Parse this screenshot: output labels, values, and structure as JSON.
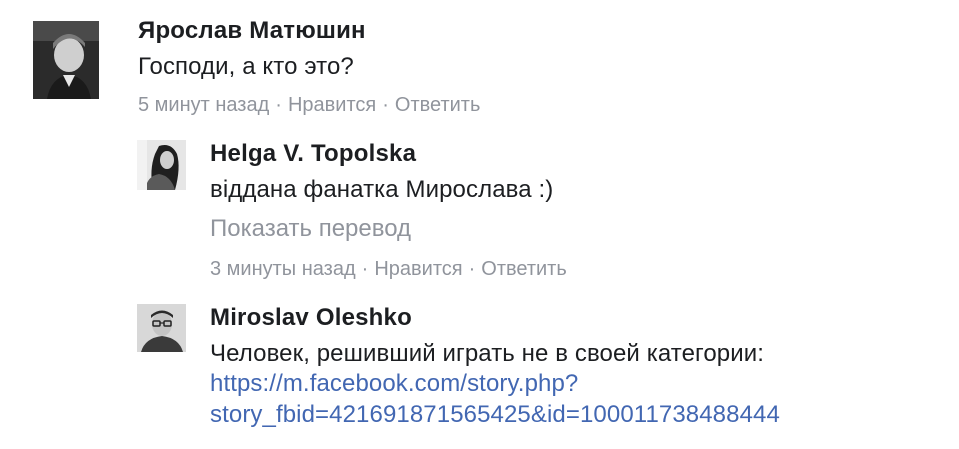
{
  "comments": [
    {
      "author": "Ярослав Матюшин",
      "text": "Господи, а кто это?",
      "time": "5 минут назад",
      "like_label": "Нравится",
      "reply_label": "Ответить",
      "separator": "·"
    },
    {
      "author": "Helga V. Topolska",
      "text": "віддана фанатка Мирослава :)",
      "translate_label": "Показать перевод",
      "time": "3 минуты назад",
      "like_label": "Нравится",
      "reply_label": "Ответить",
      "separator": "·"
    },
    {
      "author": "Miroslav Oleshko",
      "text": "Человек, решивший играть не в своей категории:",
      "link_line1": "https://m.facebook.com/story.php?",
      "link_line2": "story_fbid=421691871565425&id=100011738488444",
      "link_color": "#4267b2"
    }
  ],
  "colors": {
    "name": "#1c1e21",
    "meta": "#90949c",
    "link": "#4267b2"
  }
}
